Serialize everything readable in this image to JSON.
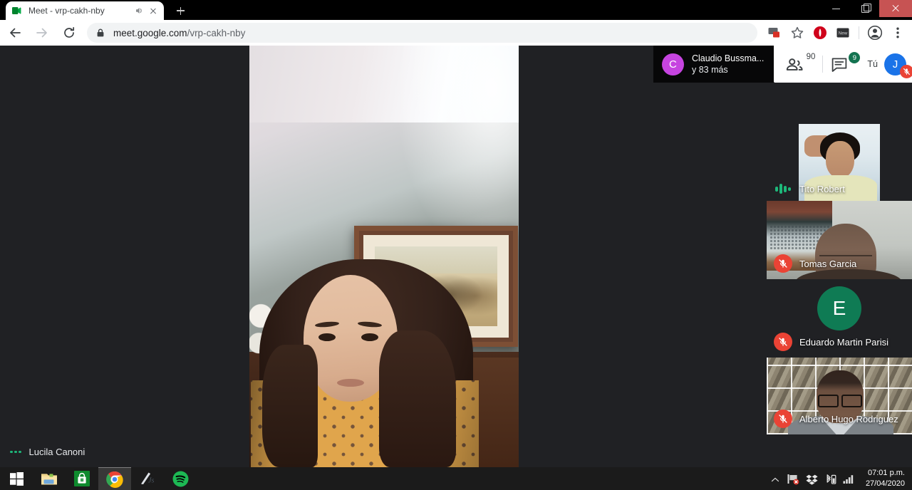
{
  "browser": {
    "tab": {
      "title": "Meet - vrp-cakh-nby",
      "favicon_name": "google-meet-favicon",
      "audio_icon_name": "tab-audio-playing-icon",
      "close_icon_name": "tab-close-icon"
    },
    "new_tab_label": "+",
    "window_controls": {
      "minimize": "minimize",
      "maximize": "restore",
      "close": "close",
      "close_color": "#c75353"
    },
    "toolbar": {
      "back": "Atrás",
      "forward": "Adelante",
      "reload": "Volver a cargar",
      "url_host": "meet.google.com",
      "url_path": "/vrp-cakh-nby",
      "lock_icon_name": "site-secure-lock-icon",
      "icons": [
        {
          "name": "cast-icon",
          "label": "Enviar"
        },
        {
          "name": "bookmark-star-icon",
          "label": "Marcador"
        },
        {
          "name": "extension-red-icon",
          "label": "Extensión",
          "color": "#d0021b"
        },
        {
          "name": "extension-new-icon",
          "label": "New",
          "color": "#2f3033"
        },
        {
          "name": "profile-avatar-icon",
          "label": "Perfil"
        },
        {
          "name": "chrome-menu-icon",
          "label": "Menú"
        }
      ]
    }
  },
  "meet": {
    "active_speaker": {
      "initial": "C",
      "avatar_color": "#c644e0",
      "name": "Claudio Bussma...",
      "others": "y 83 más"
    },
    "actions": {
      "people_icon": "people-icon",
      "people_count": "90",
      "chat_icon": "chat-icon",
      "chat_badge": "9",
      "badge_color": "#137350",
      "you_label": "Tú",
      "you_initial": "J",
      "you_avatar_color": "#1a73e8",
      "you_mic_muted": true,
      "mic_off_color": "#ea4335"
    },
    "self_view": {
      "name": "Lucila Canoni",
      "status_icon": "audio-level-dots-icon",
      "accent": "#1db87a"
    },
    "participants": [
      {
        "name": "Tito Robert",
        "status_icon": "audio-level-bars-icon",
        "muted": false,
        "has_video": true
      },
      {
        "name": "Tomas Garcia",
        "status_icon": "mic-off-icon",
        "muted": true,
        "has_video": true
      },
      {
        "name": "Eduardo Martin Parisi",
        "status_icon": "mic-off-icon",
        "muted": true,
        "has_video": false,
        "initial": "E",
        "avatar_color": "#0f7b54"
      },
      {
        "name": "Alberto Hugo Rodriguez",
        "status_icon": "mic-off-icon",
        "muted": true,
        "has_video": true
      }
    ]
  },
  "taskbar": {
    "start_label": "Inicio",
    "apps": [
      {
        "name": "file-explorer-icon",
        "label": "Explorador de archivos",
        "active": false
      },
      {
        "name": "microsoft-store-icon",
        "label": "Microsoft Store",
        "active": false
      },
      {
        "name": "google-chrome-icon",
        "label": "Google Chrome",
        "active": true
      },
      {
        "name": "vscode-js-icon",
        "label": "Visual Studio Code",
        "active": false
      },
      {
        "name": "spotify-icon",
        "label": "Spotify",
        "active": false
      }
    ],
    "tray": [
      {
        "name": "show-hidden-icons-chevron"
      },
      {
        "name": "network-error-flag-icon"
      },
      {
        "name": "dropbox-icon"
      },
      {
        "name": "bluetooth-battery-icon"
      },
      {
        "name": "wifi-signal-icon"
      }
    ],
    "clock_time": "07:01 p.m.",
    "clock_date": "27/04/2020"
  }
}
